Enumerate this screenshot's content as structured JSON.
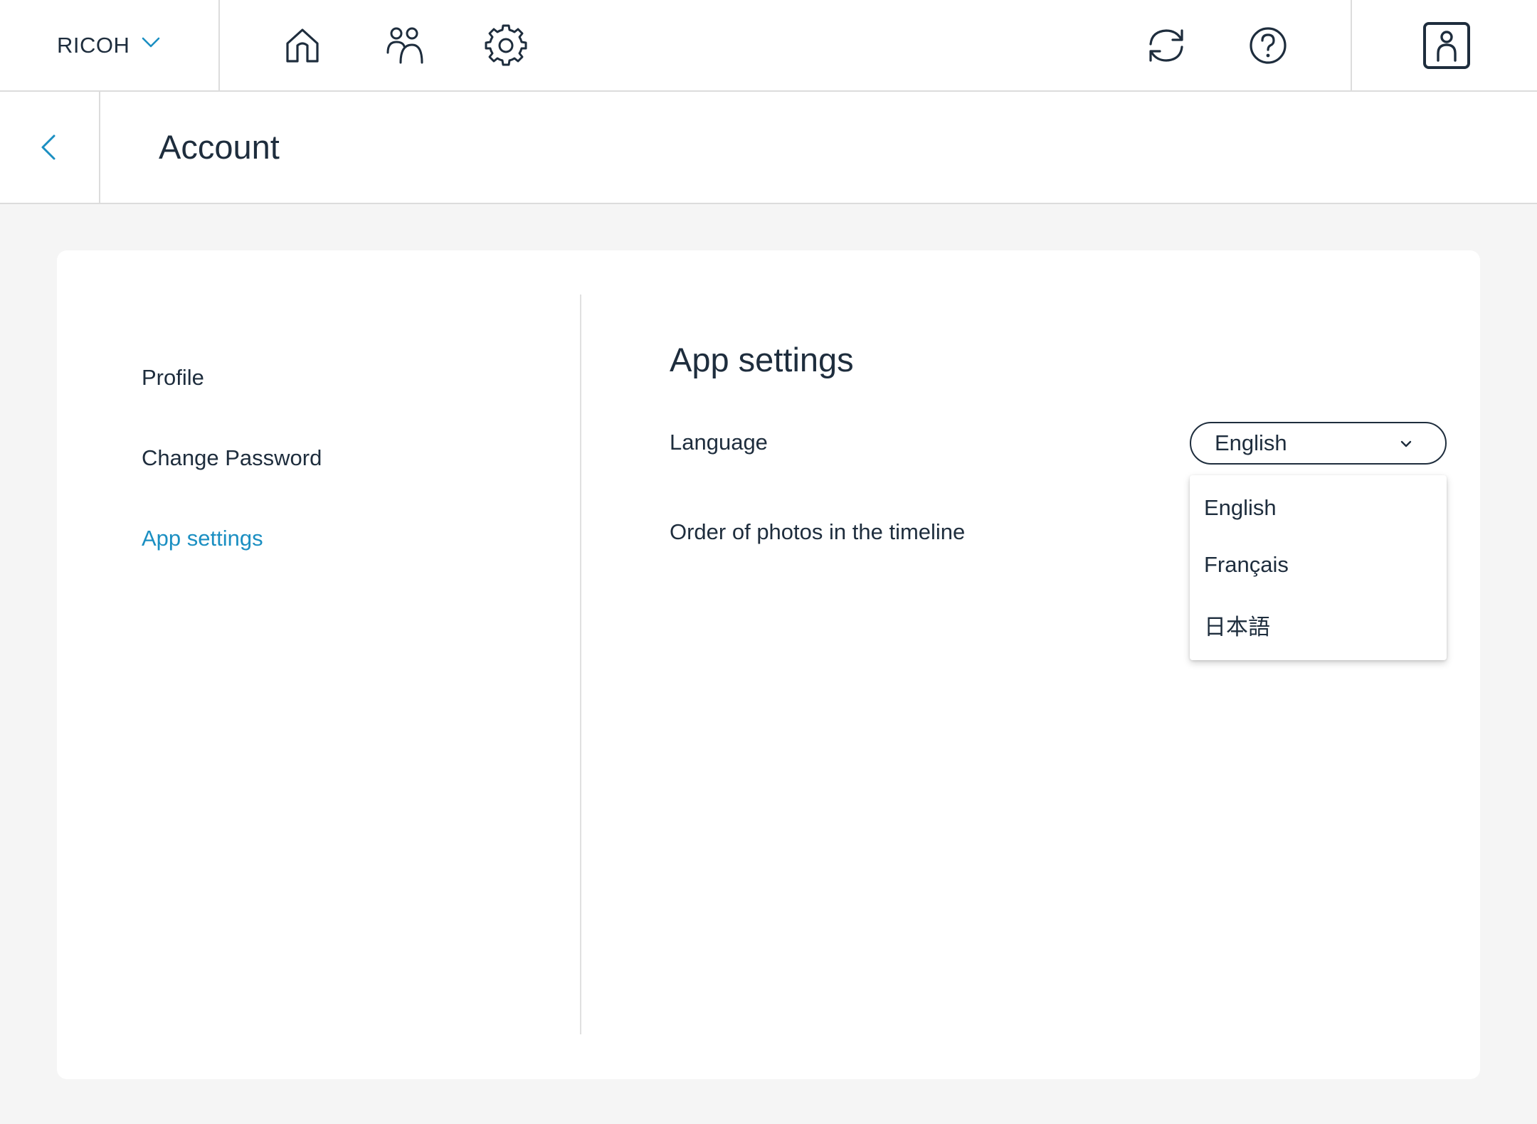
{
  "brand": {
    "label": "RICOH",
    "icon": "chevron-down-icon"
  },
  "nav": {
    "icons": [
      "home-icon",
      "people-icon",
      "gear-icon"
    ],
    "right_icons": [
      "sync-icon",
      "help-icon",
      "account-icon"
    ]
  },
  "header": {
    "back_icon": "chevron-left-icon",
    "title": "Account"
  },
  "sidebar": {
    "items": [
      {
        "label": "Profile",
        "active": false
      },
      {
        "label": "Change Password",
        "active": false
      },
      {
        "label": "App settings",
        "active": true
      }
    ]
  },
  "main": {
    "title": "App settings",
    "language_label": "Language",
    "language_value": "English",
    "order_label": "Order of photos in the timeline"
  },
  "dropdown": {
    "options": [
      "English",
      "Français",
      "日本語"
    ]
  },
  "colors": {
    "accent": "#1b8fc2",
    "text": "#1e2d3d",
    "background": "#f5f5f5",
    "card": "#ffffff",
    "border": "#dcdcdc"
  }
}
